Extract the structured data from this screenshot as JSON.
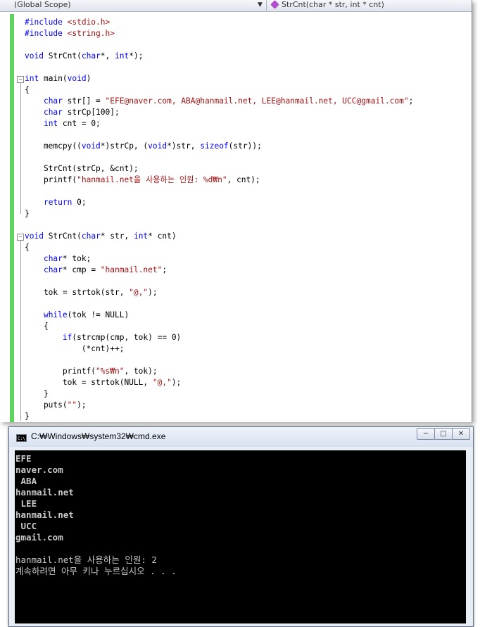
{
  "navbar": {
    "scope": "(Global Scope)",
    "function": "StrCnt(char * str, int * cnt)"
  },
  "code_lines": [
    [
      {
        "t": "#include ",
        "c": "kw"
      },
      {
        "t": "<stdio.h>",
        "c": "str"
      }
    ],
    [
      {
        "t": "#include ",
        "c": "kw"
      },
      {
        "t": "<string.h>",
        "c": "str"
      }
    ],
    [],
    [
      {
        "t": "void",
        "c": "kw"
      },
      {
        "t": " StrCnt("
      },
      {
        "t": "char",
        "c": "kw"
      },
      {
        "t": "*, "
      },
      {
        "t": "int",
        "c": "kw"
      },
      {
        "t": "*);"
      }
    ],
    [],
    [
      {
        "t": "int",
        "c": "kw"
      },
      {
        "t": " main("
      },
      {
        "t": "void",
        "c": "kw"
      },
      {
        "t": ")"
      }
    ],
    [
      {
        "t": "{"
      }
    ],
    [
      {
        "t": "    "
      },
      {
        "t": "char",
        "c": "kw"
      },
      {
        "t": " str[] = "
      },
      {
        "t": "\"EFE@naver.com, ABA@hanmail.net, LEE@hanmail.net, UCC@gmail.com\"",
        "c": "str"
      },
      {
        "t": ";"
      }
    ],
    [
      {
        "t": "    "
      },
      {
        "t": "char",
        "c": "kw"
      },
      {
        "t": " strCp[100];"
      }
    ],
    [
      {
        "t": "    "
      },
      {
        "t": "int",
        "c": "kw"
      },
      {
        "t": " cnt = 0;"
      }
    ],
    [],
    [
      {
        "t": "    memcpy(("
      },
      {
        "t": "void",
        "c": "kw"
      },
      {
        "t": "*)strCp, ("
      },
      {
        "t": "void",
        "c": "kw"
      },
      {
        "t": "*)str, "
      },
      {
        "t": "sizeof",
        "c": "kw"
      },
      {
        "t": "(str));"
      }
    ],
    [],
    [
      {
        "t": "    StrCnt(strCp, &cnt);"
      }
    ],
    [
      {
        "t": "    printf("
      },
      {
        "t": "\"hanmail.net을 사용하는 인원: %d₩n\"",
        "c": "str"
      },
      {
        "t": ", cnt);"
      }
    ],
    [],
    [
      {
        "t": "    "
      },
      {
        "t": "return",
        "c": "kw"
      },
      {
        "t": " 0;"
      }
    ],
    [
      {
        "t": "}"
      }
    ],
    [],
    [
      {
        "t": "void",
        "c": "kw"
      },
      {
        "t": " StrCnt("
      },
      {
        "t": "char",
        "c": "kw"
      },
      {
        "t": "* str, "
      },
      {
        "t": "int",
        "c": "kw"
      },
      {
        "t": "* cnt)"
      }
    ],
    [
      {
        "t": "{"
      }
    ],
    [
      {
        "t": "    "
      },
      {
        "t": "char",
        "c": "kw"
      },
      {
        "t": "* tok;"
      }
    ],
    [
      {
        "t": "    "
      },
      {
        "t": "char",
        "c": "kw"
      },
      {
        "t": "* cmp = "
      },
      {
        "t": "\"hanmail.net\"",
        "c": "str"
      },
      {
        "t": ";"
      }
    ],
    [],
    [
      {
        "t": "    tok = strtok(str, "
      },
      {
        "t": "\"@,\"",
        "c": "str"
      },
      {
        "t": ");"
      }
    ],
    [],
    [
      {
        "t": "    "
      },
      {
        "t": "while",
        "c": "kw"
      },
      {
        "t": "(tok != NULL)"
      }
    ],
    [
      {
        "t": "    {"
      }
    ],
    [
      {
        "t": "        "
      },
      {
        "t": "if",
        "c": "kw"
      },
      {
        "t": "(strcmp(cmp, tok) == 0)"
      }
    ],
    [
      {
        "t": "            (*cnt)++;"
      }
    ],
    [],
    [
      {
        "t": "        printf("
      },
      {
        "t": "\"%s₩n\"",
        "c": "str"
      },
      {
        "t": ", tok);"
      }
    ],
    [
      {
        "t": "        tok = strtok(NULL, "
      },
      {
        "t": "\"@,\"",
        "c": "str"
      },
      {
        "t": ");"
      }
    ],
    [
      {
        "t": "    }"
      }
    ],
    [
      {
        "t": "    puts("
      },
      {
        "t": "\"\"",
        "c": "str"
      },
      {
        "t": ");"
      }
    ],
    [
      {
        "t": "}"
      }
    ]
  ],
  "console": {
    "title": "C:₩Windows₩system32₩cmd.exe",
    "icon_label": "C:\\",
    "buttons": {
      "minimize": "─",
      "maximize": "□",
      "close": "✕"
    },
    "lines": [
      "EFE",
      "naver.com",
      " ABA",
      "hanmail.net",
      " LEE",
      "hanmail.net",
      " UCC",
      "gmail.com",
      "",
      "hanmail.net을 사용하는 인원: 2",
      "계속하려면 아무 키나 누르십시오 . . ."
    ]
  }
}
